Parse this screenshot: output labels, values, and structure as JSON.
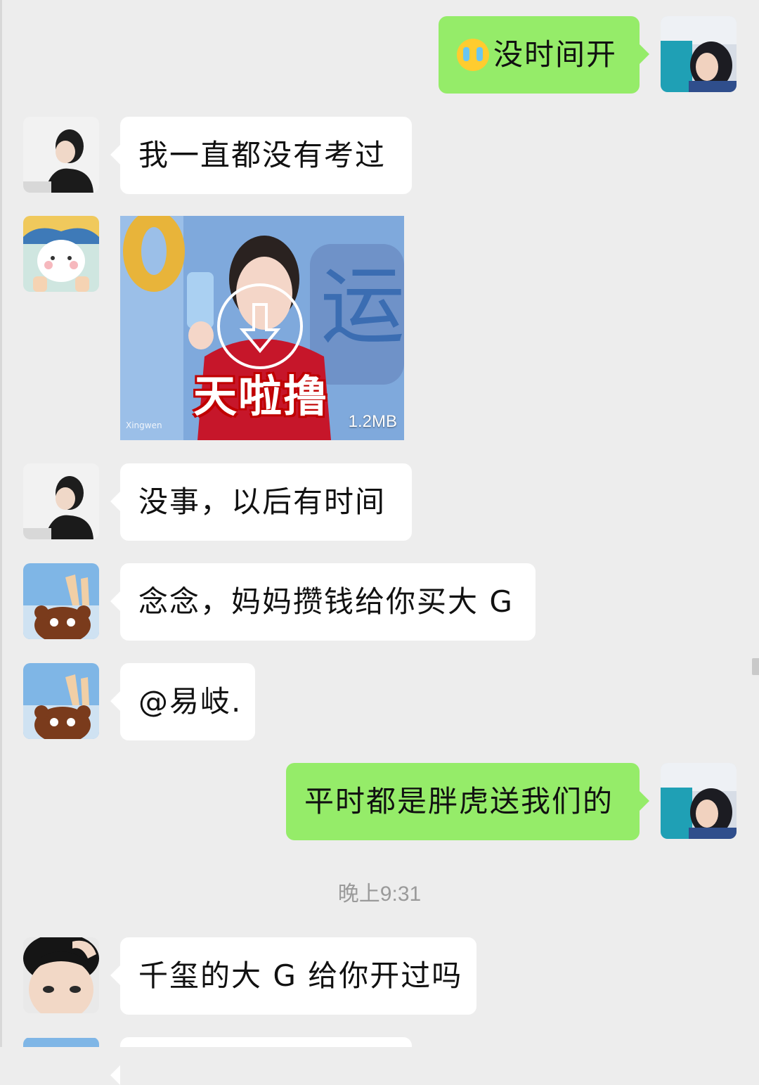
{
  "messages": [
    {
      "side": "out",
      "text": "没时间开",
      "emoji": "crying-face-icon"
    },
    {
      "side": "in",
      "text": "我一直都没有考过"
    },
    {
      "side": "in",
      "type": "video",
      "caption": "天啦撸",
      "size": "1.2MB"
    },
    {
      "side": "in",
      "text": "没事，以后有时间"
    },
    {
      "side": "in",
      "text": "念念，妈妈攒钱给你买大 G"
    },
    {
      "side": "in",
      "text": "@易岐."
    },
    {
      "side": "out",
      "text": "平时都是胖虎送我们的"
    },
    {
      "side": "in",
      "text": "千玺的大 G 给你开过吗"
    }
  ],
  "timestamp": "晚上9:31",
  "colors": {
    "background": "#ededed",
    "incoming": "#ffffff",
    "outgoing": "#95ec69",
    "timestamp": "#9a9a9a"
  }
}
